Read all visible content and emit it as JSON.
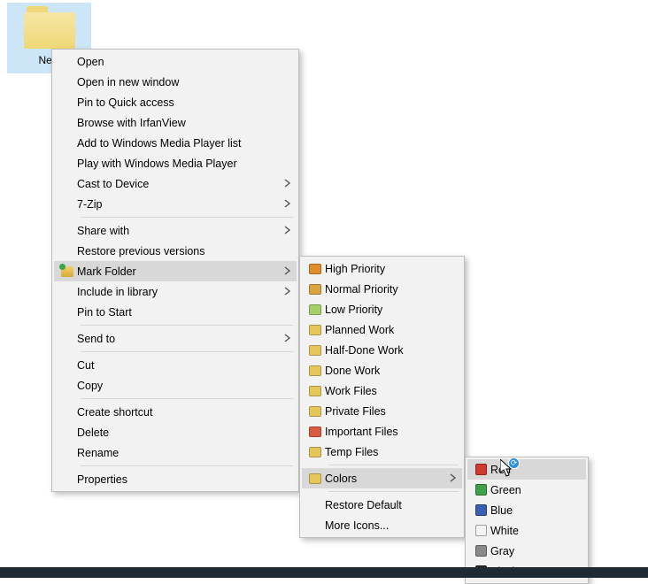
{
  "desktop": {
    "folder_label": "New"
  },
  "menu1": {
    "items": [
      {
        "id": "open",
        "label": "Open"
      },
      {
        "id": "open-new-window",
        "label": "Open in new window"
      },
      {
        "id": "pin-quick",
        "label": "Pin to Quick access"
      },
      {
        "id": "irfanview",
        "label": "Browse with IrfanView"
      },
      {
        "id": "add-wmp",
        "label": "Add to Windows Media Player list"
      },
      {
        "id": "play-wmp",
        "label": "Play with Windows Media Player"
      },
      {
        "id": "cast",
        "label": "Cast to Device",
        "submenu": true
      },
      {
        "id": "7zip",
        "label": "7-Zip",
        "submenu": true
      },
      {
        "sep": true
      },
      {
        "id": "share-with",
        "label": "Share with",
        "submenu": true
      },
      {
        "id": "restore-prev",
        "label": "Restore previous versions"
      },
      {
        "id": "mark-folder",
        "label": "Mark Folder",
        "submenu": true,
        "highlight": true,
        "icon": "mark-folder"
      },
      {
        "id": "include-lib",
        "label": "Include in library",
        "submenu": true
      },
      {
        "id": "pin-start",
        "label": "Pin to Start"
      },
      {
        "sep": true
      },
      {
        "id": "send-to",
        "label": "Send to",
        "submenu": true
      },
      {
        "sep": true
      },
      {
        "id": "cut",
        "label": "Cut"
      },
      {
        "id": "copy",
        "label": "Copy"
      },
      {
        "sep": true
      },
      {
        "id": "shortcut",
        "label": "Create shortcut"
      },
      {
        "id": "delete",
        "label": "Delete"
      },
      {
        "id": "rename",
        "label": "Rename"
      },
      {
        "sep": true
      },
      {
        "id": "properties",
        "label": "Properties"
      }
    ]
  },
  "menu2": {
    "items": [
      {
        "id": "high-priority",
        "label": "High Priority",
        "icon_color": "#e08b2c"
      },
      {
        "id": "normal-priority",
        "label": "Normal Priority",
        "icon_color": "#d9a441"
      },
      {
        "id": "low-priority",
        "label": "Low Priority",
        "icon_color": "#a6cf6a"
      },
      {
        "id": "planned-work",
        "label": "Planned Work",
        "icon_color": "#e4c65b"
      },
      {
        "id": "half-done",
        "label": "Half-Done Work",
        "icon_color": "#e4c65b"
      },
      {
        "id": "done-work",
        "label": "Done Work",
        "icon_color": "#e4c65b"
      },
      {
        "id": "work-files",
        "label": "Work Files",
        "icon_color": "#e4c65b"
      },
      {
        "id": "private-files",
        "label": "Private Files",
        "icon_color": "#e4c65b"
      },
      {
        "id": "important",
        "label": "Important Files",
        "icon_color": "#d85a3f"
      },
      {
        "id": "temp-files",
        "label": "Temp Files",
        "icon_color": "#e4c65b"
      },
      {
        "sep": true
      },
      {
        "id": "colors",
        "label": "Colors",
        "submenu": true,
        "highlight": true,
        "icon_color": "#e4c65b"
      },
      {
        "sep": true
      },
      {
        "id": "restore-default",
        "label": "Restore Default"
      },
      {
        "id": "more-icons",
        "label": "More Icons..."
      }
    ]
  },
  "menu3": {
    "items": [
      {
        "id": "red",
        "label": "Red",
        "color": "#d13a2e",
        "highlight": true
      },
      {
        "id": "green",
        "label": "Green",
        "color": "#3fa24a"
      },
      {
        "id": "blue",
        "label": "Blue",
        "color": "#3a5fb0"
      },
      {
        "id": "white",
        "label": "White",
        "color": "#f3f3f3"
      },
      {
        "id": "gray",
        "label": "Gray",
        "color": "#8a8a8a"
      },
      {
        "id": "black",
        "label": "Black",
        "color": "#2a2a2a"
      }
    ]
  }
}
